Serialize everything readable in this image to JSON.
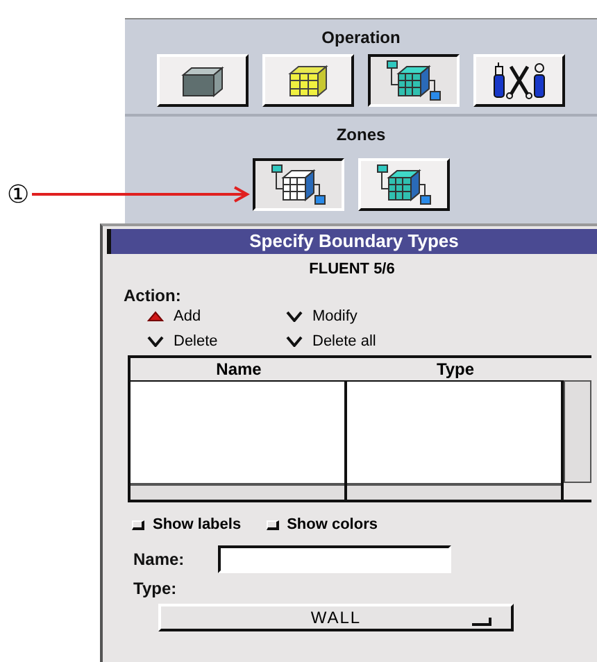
{
  "callout": {
    "label": "①"
  },
  "operation": {
    "title": "Operation",
    "buttons": [
      {
        "kind": "block",
        "selected": false
      },
      {
        "kind": "grid",
        "selected": false
      },
      {
        "kind": "grid-linked",
        "selected": true
      },
      {
        "kind": "tools",
        "selected": false
      }
    ]
  },
  "zones": {
    "title": "Zones",
    "buttons": [
      {
        "kind": "grid-linked-white",
        "selected": true
      },
      {
        "kind": "grid-linked",
        "selected": false
      }
    ]
  },
  "dialog": {
    "title": "Specify Boundary Types",
    "subtitle": "FLUENT 5/6",
    "action_label": "Action:",
    "actions": [
      {
        "label": "Add",
        "selected": true
      },
      {
        "label": "Modify",
        "selected": false
      },
      {
        "label": "Delete",
        "selected": false
      },
      {
        "label": "Delete all",
        "selected": false
      }
    ],
    "table": {
      "columns": [
        "Name",
        "Type"
      ]
    },
    "options": [
      {
        "label": "Show labels",
        "checked": false
      },
      {
        "label": "Show colors",
        "checked": false
      }
    ],
    "name_label": "Name:",
    "type_label": "Type:",
    "type_value": "WALL"
  }
}
